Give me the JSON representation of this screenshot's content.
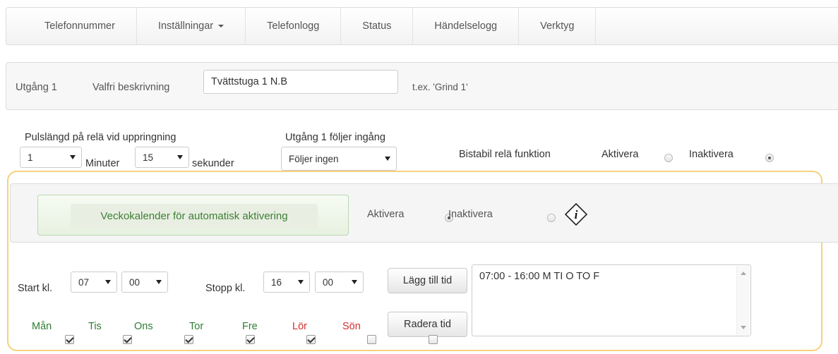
{
  "nav": {
    "items": [
      {
        "label": "Telefonnummer"
      },
      {
        "label": "Inställningar",
        "dropdown": true
      },
      {
        "label": "Telefonlogg"
      },
      {
        "label": "Status"
      },
      {
        "label": "Händelselogg"
      },
      {
        "label": "Verktyg"
      }
    ]
  },
  "output": {
    "label": "Utgång 1",
    "desc_label": "Valfri beskrivning",
    "desc_value": "Tvättstuga 1 N.B",
    "example": "t.ex. 'Grind 1'"
  },
  "pulse": {
    "label": "Pulslängd på relä vid uppringning",
    "minutes_value": "1",
    "minutes_label": "Minuter",
    "seconds_value": "15",
    "seconds_label": "sekunder"
  },
  "follow": {
    "label": "Utgång 1 följer ingång",
    "value": "Följer ingen"
  },
  "bistable": {
    "label": "Bistabil relä funktion",
    "activate": "Aktivera",
    "deactivate": "Inaktivera",
    "selected": "Inaktivera"
  },
  "week": {
    "title": "Veckokalender för automatisk aktivering",
    "activate": "Aktivera",
    "deactivate": "Inaktivera",
    "selected": "Aktivera",
    "info_icon": "info-icon",
    "start_label": "Start kl.",
    "start_hour": "07",
    "start_min": "00",
    "stop_label": "Stopp kl.",
    "stop_hour": "16",
    "stop_min": "00",
    "add_button": "Lägg till tid",
    "delete_button": "Radera tid",
    "schedule_text": "07:00 - 16:00 M TI O TO F",
    "days": [
      {
        "label": "Mån",
        "checked": true,
        "color": "#2e7d32"
      },
      {
        "label": "Tis",
        "checked": true,
        "color": "#2e7d32"
      },
      {
        "label": "Ons",
        "checked": true,
        "color": "#2e7d32"
      },
      {
        "label": "Tor",
        "checked": true,
        "color": "#2e7d32"
      },
      {
        "label": "Fre",
        "checked": true,
        "color": "#2e7d32"
      },
      {
        "label": "Lör",
        "checked": false,
        "color": "#d32f2f"
      },
      {
        "label": "Sön",
        "checked": false,
        "color": "#d32f2f"
      }
    ]
  },
  "colors": {
    "highlight_border": "#f5d27a",
    "week_title": "#3e7d35",
    "weekday": "#2e7d32",
    "weekend": "#d32f2f"
  }
}
